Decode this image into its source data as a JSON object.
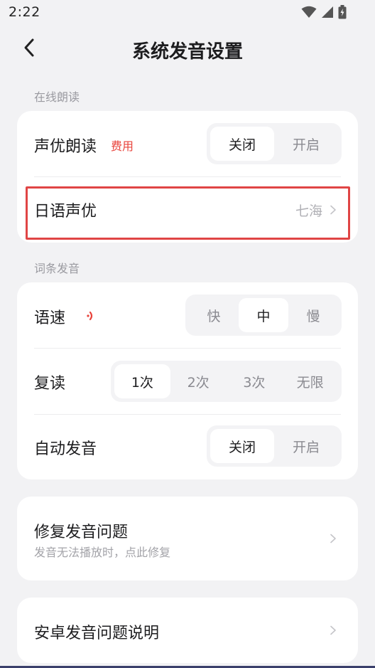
{
  "status_bar": {
    "time": "2:22",
    "icons": [
      "wifi-icon",
      "signal-icon",
      "battery-charging-icon"
    ]
  },
  "header": {
    "title": "系统发音设置",
    "back_icon": "chevron-left-icon"
  },
  "online_reading": {
    "section_label": "在线朗读",
    "voice_actor_reading": {
      "label": "声优朗读",
      "badge": "费用",
      "options": [
        "关闭",
        "开启"
      ],
      "selected": "关闭"
    },
    "japanese_voice_actor": {
      "label": "日语声优",
      "value": "七海"
    }
  },
  "word_pronunciation": {
    "section_label": "词条发音",
    "speed": {
      "label": "语速",
      "icon": "sound-wave-icon",
      "options": [
        "快",
        "中",
        "慢"
      ],
      "selected": "中"
    },
    "repeat": {
      "label": "复读",
      "options": [
        "1次",
        "2次",
        "3次",
        "无限"
      ],
      "selected": "1次"
    },
    "auto_play": {
      "label": "自动发音",
      "options": [
        "关闭",
        "开启"
      ],
      "selected": "关闭"
    }
  },
  "fix_pronunciation": {
    "title": "修复发音问题",
    "subtitle": "发音无法播放时，点此修复"
  },
  "android_help": {
    "title": "安卓发音问题说明"
  },
  "colors": {
    "background": "#f2f2f4",
    "card": "#ffffff",
    "accent_red": "#e8433b",
    "highlight_border": "#e04545"
  }
}
